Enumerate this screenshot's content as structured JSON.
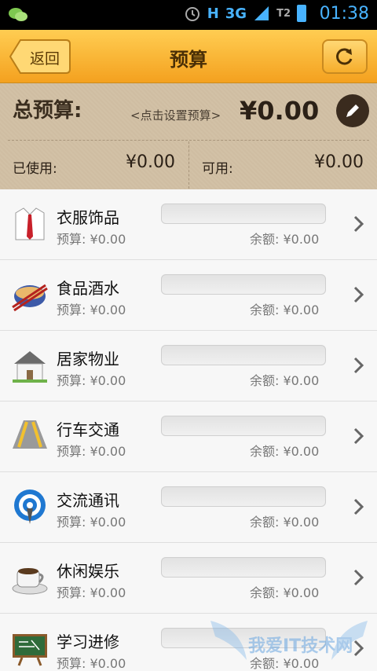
{
  "status_bar": {
    "time": "01:38",
    "network": "3G",
    "h_label": "H",
    "sim2_label": "T2"
  },
  "header": {
    "back_label": "返回",
    "title": "预算"
  },
  "summary": {
    "total_label": "总预算:",
    "hint": "<点击设置预算>",
    "total_value": "¥0.00",
    "used_label": "已使用:",
    "used_value": "¥0.00",
    "available_label": "可用:",
    "available_value": "¥0.00"
  },
  "categories": [
    {
      "name": "衣服饰品",
      "budget": "预算: ¥0.00",
      "remaining": "余额: ¥0.00",
      "icon": "shirt-icon"
    },
    {
      "name": "食品酒水",
      "budget": "预算: ¥0.00",
      "remaining": "余额: ¥0.00",
      "icon": "food-bowl-icon"
    },
    {
      "name": "居家物业",
      "budget": "预算: ¥0.00",
      "remaining": "余额: ¥0.00",
      "icon": "house-icon"
    },
    {
      "name": "行车交通",
      "budget": "预算: ¥0.00",
      "remaining": "余额: ¥0.00",
      "icon": "road-icon"
    },
    {
      "name": "交流通讯",
      "budget": "预算: ¥0.00",
      "remaining": "余额: ¥0.00",
      "icon": "signal-icon"
    },
    {
      "name": "休闲娱乐",
      "budget": "预算: ¥0.00",
      "remaining": "余额: ¥0.00",
      "icon": "coffee-icon"
    },
    {
      "name": "学习进修",
      "budget": "预算: ¥0.00",
      "remaining": "余额: ¥0.00",
      "icon": "chalkboard-icon"
    }
  ],
  "watermark": {
    "text": "我爱IT技术网"
  },
  "colors": {
    "header": "#f4a11f",
    "summary_bg": "#d2c1a6",
    "status_accent": "#48b3ff"
  }
}
